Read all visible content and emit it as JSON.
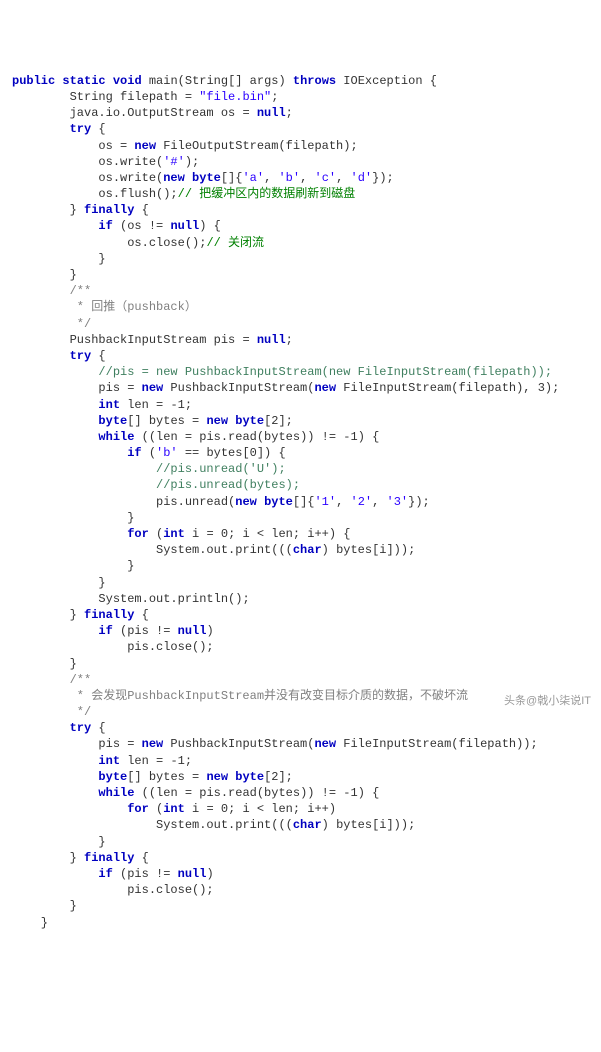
{
  "code": {
    "l1a": "public",
    "l1b": "static",
    "l1c": "void",
    "l1d": " main(String[] args) ",
    "l1e": "throws",
    "l1f": " IOException {",
    "l2a": "        String filepath = ",
    "l2b": "\"file.bin\"",
    "l2c": ";",
    "l3": "        java.io.OutputStream os = ",
    "l3b": "null",
    "l3c": ";",
    "l4": "        ",
    "l4b": "try",
    "l4c": " {",
    "l5a": "            os = ",
    "l5b": "new",
    "l5c": " FileOutputStream(filepath);",
    "l6a": "            os.write(",
    "l6b": "'#'",
    "l6c": ");",
    "l7a": "            os.write(",
    "l7b": "new",
    "l7c": " ",
    "l7d": "byte",
    "l7e": "[]{",
    "l7f": "'a'",
    "l7g": ", ",
    "l7h": "'b'",
    "l7i": ", ",
    "l7j": "'c'",
    "l7k": ", ",
    "l7l": "'d'",
    "l7m": "});",
    "l8a": "            os.flush();",
    "l8b": "// 把缓冲区内的数据刷新到磁盘",
    "l9a": "        } ",
    "l9b": "finally",
    "l9c": " {",
    "l10a": "            ",
    "l10b": "if",
    "l10c": " (os != ",
    "l10d": "null",
    "l10e": ") {",
    "l11a": "                os.close();",
    "l11b": "// 关闭流",
    "l12": "            }",
    "l13": "        }",
    "l14": "        /**",
    "l15": "         * 回推（pushback）",
    "l16": "         */",
    "l17a": "        PushbackInputStream pis = ",
    "l17b": "null",
    "l17c": ";",
    "l18a": "        ",
    "l18b": "try",
    "l18c": " {",
    "l19": "            //pis = new PushbackInputStream(new FileInputStream(filepath));",
    "l20a": "            pis = ",
    "l20b": "new",
    "l20c": " PushbackInputStream(",
    "l20d": "new",
    "l20e": " FileInputStream(filepath), ",
    "l20f": "3",
    "l20g": ");",
    "l21a": "            ",
    "l21b": "int",
    "l21c": " len = -",
    "l21d": "1",
    "l21e": ";",
    "l22a": "            ",
    "l22b": "byte",
    "l22c": "[] bytes = ",
    "l22d": "new",
    "l22e": " ",
    "l22f": "byte",
    "l22g": "[",
    "l22h": "2",
    "l22i": "];",
    "l23a": "            ",
    "l23b": "while",
    "l23c": " ((len = pis.read(bytes)) != -",
    "l23d": "1",
    "l23e": ") {",
    "l24a": "                ",
    "l24b": "if",
    "l24c": " (",
    "l24d": "'b'",
    "l24e": " == bytes[",
    "l24f": "0",
    "l24g": "]) {",
    "l25": "                    //pis.unread('U');",
    "l26": "                    //pis.unread(bytes);",
    "l27a": "                    pis.unread(",
    "l27b": "new",
    "l27c": " ",
    "l27d": "byte",
    "l27e": "[]{",
    "l27f": "'1'",
    "l27g": ", ",
    "l27h": "'2'",
    "l27i": ", ",
    "l27j": "'3'",
    "l27k": "});",
    "l28": "                }",
    "l29a": "                ",
    "l29b": "for",
    "l29c": " (",
    "l29d": "int",
    "l29e": " i = ",
    "l29f": "0",
    "l29g": "; i < len; i++) {",
    "l30a": "                    System.out.print(((",
    "l30b": "char",
    "l30c": ") bytes[i]));",
    "l31": "                }",
    "l32": "            }",
    "l33": "            System.out.println();",
    "l34a": "        } ",
    "l34b": "finally",
    "l34c": " {",
    "l35a": "            ",
    "l35b": "if",
    "l35c": " (pis != ",
    "l35d": "null",
    "l35e": ")",
    "l36": "                pis.close();",
    "l37": "        }",
    "l38": "        /**",
    "l39": "         * 会发现PushbackInputStream并没有改变目标介质的数据，不破坏流",
    "l40": "         */",
    "l41a": "        ",
    "l41b": "try",
    "l41c": " {",
    "l42a": "            pis = ",
    "l42b": "new",
    "l42c": " PushbackInputStream(",
    "l42d": "new",
    "l42e": " FileInputStream(filepath));",
    "l43a": "            ",
    "l43b": "int",
    "l43c": " len = -",
    "l43d": "1",
    "l43e": ";",
    "l44a": "            ",
    "l44b": "byte",
    "l44c": "[] bytes = ",
    "l44d": "new",
    "l44e": " ",
    "l44f": "byte",
    "l44g": "[",
    "l44h": "2",
    "l44i": "];",
    "l45a": "            ",
    "l45b": "while",
    "l45c": " ((len = pis.read(bytes)) != -",
    "l45d": "1",
    "l45e": ") {",
    "l46a": "                ",
    "l46b": "for",
    "l46c": " (",
    "l46d": "int",
    "l46e": " i = ",
    "l46f": "0",
    "l46g": "; i < len; i++)",
    "l47a": "                    System.out.print(((",
    "l47b": "char",
    "l47c": ") bytes[i]));",
    "l48": "            }",
    "l49a": "        } ",
    "l49b": "finally",
    "l49c": " {",
    "l50a": "            ",
    "l50b": "if",
    "l50c": " (pis != ",
    "l50d": "null",
    "l50e": ")",
    "l51": "                pis.close();",
    "l52": "        }",
    "l53": "    }"
  },
  "watermark": "头条@戟小柒说IT"
}
